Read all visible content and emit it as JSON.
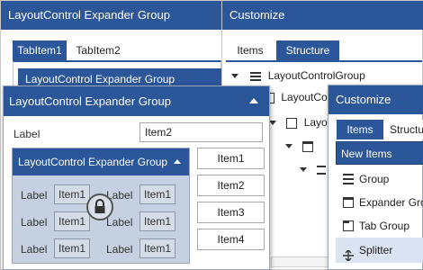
{
  "layout_window": {
    "title": "LayoutControl Expander Group",
    "tabs": [
      {
        "label": "TabItem1",
        "active": true
      },
      {
        "label": "TabItem2",
        "active": false
      }
    ],
    "tab_content_header": "LayoutControl Expander Group"
  },
  "customize_window": {
    "title": "Customize",
    "tabs": [
      {
        "label": "Items",
        "active": false
      },
      {
        "label": "Structure",
        "active": true
      }
    ],
    "tree": [
      {
        "label": "LayoutControlGroup",
        "icon": "list-icon",
        "expanded": true
      },
      {
        "label": "LayoutControl",
        "icon": "group-icon",
        "expanded": true
      },
      {
        "label": "Layo",
        "icon": "group-icon",
        "expanded": true
      },
      {
        "label": "",
        "icon": "tab-group-icon",
        "expanded": true
      },
      {
        "label": "",
        "icon": "list-icon",
        "expanded": true
      }
    ]
  },
  "expander_popup": {
    "title": "LayoutControl Expander Group",
    "label": "Label",
    "item2_value": "Item2",
    "inner_group": {
      "title": "LayoutControl Expander Group",
      "rows": [
        {
          "left_label": "Label",
          "left_item": "Item1",
          "right_label": "Label",
          "right_item": "Item1"
        },
        {
          "left_label": "Label",
          "left_item": "Item1",
          "right_label": "Label",
          "right_item": "Item1"
        },
        {
          "left_label": "Label",
          "left_item": "Item1",
          "right_label": "Label",
          "right_item": "Item1"
        }
      ],
      "lock_icon": "lock-icon"
    },
    "side_items": [
      "Item1",
      "Item2",
      "Item3",
      "Item4"
    ]
  },
  "customize_popup": {
    "title": "Customize",
    "tabs": [
      {
        "label": "Items",
        "active": true
      },
      {
        "label": "Structu",
        "active": false
      }
    ],
    "section_header": "New Items",
    "items": [
      {
        "label": "Group",
        "icon": "list-icon"
      },
      {
        "label": "Expander Gro",
        "icon": "expander-group-icon"
      },
      {
        "label": "Tab Group",
        "icon": "tab-group-icon"
      },
      {
        "label": "Splitter",
        "icon": "splitter-icon"
      }
    ]
  },
  "colors": {
    "accent": "#2b579a",
    "inner_group_bg": "#c5d0e0",
    "selection": "#d9e3f1"
  }
}
